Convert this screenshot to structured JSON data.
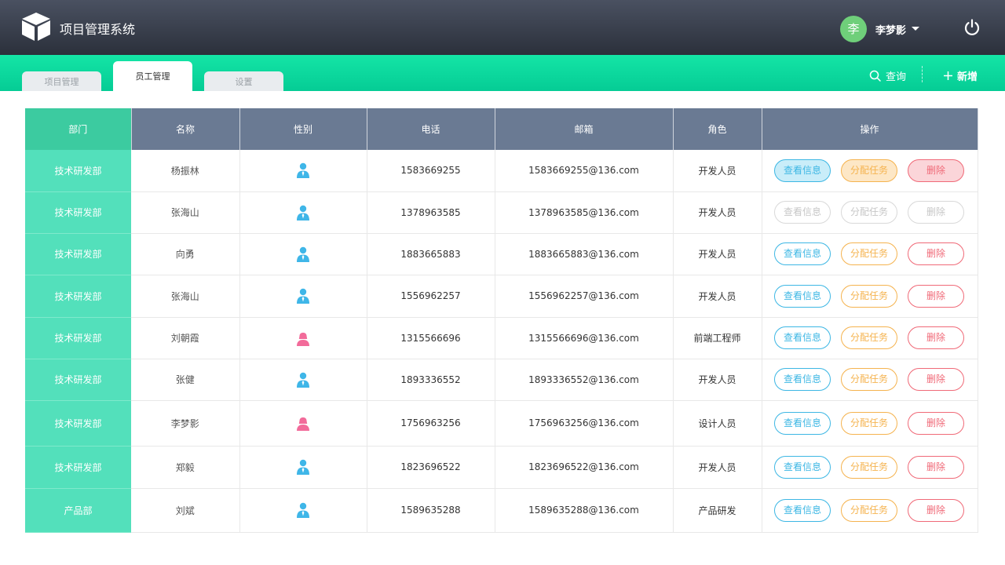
{
  "header": {
    "app_title": "项目管理系统",
    "avatar_text": "李",
    "username": "李梦影"
  },
  "tabs": [
    {
      "label": "项目管理",
      "active": false
    },
    {
      "label": "员工管理",
      "active": true
    },
    {
      "label": "设置",
      "active": false
    }
  ],
  "toolbar": {
    "query_label": "查询",
    "add_label": "新增"
  },
  "table": {
    "columns": [
      "部门",
      "名称",
      "性别",
      "电话",
      "邮箱",
      "角色",
      "操作"
    ],
    "actions": {
      "view": "查看信息",
      "assign": "分配任务",
      "delete": "删除"
    },
    "rows": [
      {
        "dept": "技术研发部",
        "name": "杨振林",
        "gender": "male",
        "phone": "1583669255",
        "email": "1583669255@136.com",
        "role": "开发人员",
        "state": "hover"
      },
      {
        "dept": "技术研发部",
        "name": "张海山",
        "gender": "male",
        "phone": "1378963585",
        "email": "1378963585@136.com",
        "role": "开发人员",
        "state": "disabled"
      },
      {
        "dept": "技术研发部",
        "name": "向勇",
        "gender": "male",
        "phone": "1883665883",
        "email": "1883665883@136.com",
        "role": "开发人员",
        "state": "normal"
      },
      {
        "dept": "技术研发部",
        "name": "张海山",
        "gender": "male",
        "phone": "1556962257",
        "email": "1556962257@136.com",
        "role": "开发人员",
        "state": "normal"
      },
      {
        "dept": "技术研发部",
        "name": "刘朝霞",
        "gender": "female",
        "phone": "1315566696",
        "email": "1315566696@136.com",
        "role": "前端工程师",
        "state": "normal"
      },
      {
        "dept": "技术研发部",
        "name": "张健",
        "gender": "male",
        "phone": "1893336552",
        "email": "1893336552@136.com",
        "role": "开发人员",
        "state": "normal"
      },
      {
        "dept": "技术研发部",
        "name": "李梦影",
        "gender": "female",
        "phone": "1756963256",
        "email": "1756963256@136.com",
        "role": "设计人员",
        "state": "normal"
      },
      {
        "dept": "技术研发部",
        "name": "郑毅",
        "gender": "male",
        "phone": "1823696522",
        "email": "1823696522@136.com",
        "role": "开发人员",
        "state": "normal"
      },
      {
        "dept": "产品部",
        "name": "刘斌",
        "gender": "male",
        "phone": "1589635288",
        "email": "1589635288@136.com",
        "role": "产品研发",
        "state": "normal"
      }
    ]
  },
  "colors": {
    "header_dark": "#2b303b",
    "accent_green": "#05cc95",
    "dept_cell": "#53e0bb",
    "view_blue": "#3db7e4",
    "assign_orange": "#f5b34f",
    "delete_red": "#f06a78",
    "male_icon": "#3fb6e8",
    "female_icon": "#f26b9a"
  },
  "icons": {
    "logo": "cube-icon",
    "power": "power-icon",
    "query": "search-icon",
    "add": "plus-icon",
    "male": "male-user-icon",
    "female": "female-user-icon"
  }
}
